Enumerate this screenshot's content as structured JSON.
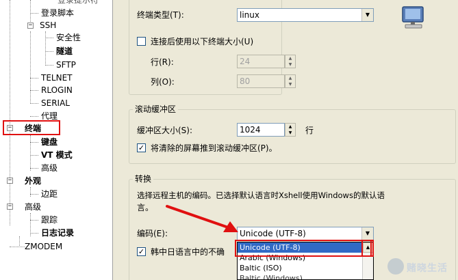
{
  "tree": {
    "items": [
      {
        "label": "登录提示符"
      },
      {
        "label": "登录脚本"
      },
      {
        "label": "SSH"
      },
      {
        "label": "安全性"
      },
      {
        "label": "隧道"
      },
      {
        "label": "SFTP"
      },
      {
        "label": "TELNET"
      },
      {
        "label": "RLOGIN"
      },
      {
        "label": "SERIAL"
      },
      {
        "label": "代理"
      },
      {
        "label": "终端"
      },
      {
        "label": "键盘"
      },
      {
        "label": "VT 模式"
      },
      {
        "label": "高级"
      },
      {
        "label": "外观"
      },
      {
        "label": "边距"
      },
      {
        "label": "高级"
      },
      {
        "label": "跟踪"
      },
      {
        "label": "日志记录"
      },
      {
        "label": "ZMODEM"
      }
    ]
  },
  "terminal": {
    "type_label": "终端类型(T):",
    "type_value": "linux",
    "use_size_label": "连接后使用以下终端大小(U)",
    "rows_label": "行(R):",
    "rows_value": "24",
    "cols_label": "列(O):",
    "cols_value": "80"
  },
  "scrollback": {
    "title": "滚动缓冲区",
    "size_label": "缓冲区大小(S):",
    "size_value": "1024",
    "unit": "行",
    "push_label": "将清除的屏幕推到滚动缓冲区(P)。"
  },
  "conversion": {
    "title": "转换",
    "description_line1": "选择远程主机的编码。已选择默认语言时Xshell使用Windows的默认语",
    "description_line2": "言。",
    "encoding_label": "编码(E):",
    "encoding_value": "Unicode (UTF-8)",
    "cjk_label": "韩中日语言中的不确",
    "dropdown_options": [
      "Unicode (UTF-8)",
      "Arabic (Windows)",
      "Baltic (ISO)",
      "Baltic (Windows)"
    ]
  },
  "watermark": {
    "text": "赌晓生活"
  }
}
